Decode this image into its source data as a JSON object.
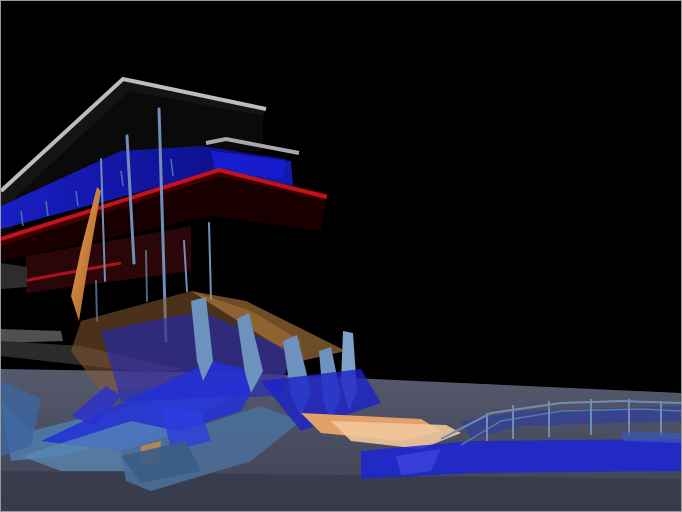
{
  "image": {
    "description_tag": "3d-architectural-render",
    "palette": {
      "background": "#000000",
      "ground": "#4b4f63",
      "deep_blue": "#1414c8",
      "steel_blue": "#5b7fa8",
      "red_edge": "#c2141e",
      "orange": "#e08a3c",
      "roof_gray": "#b8b8b8"
    }
  }
}
